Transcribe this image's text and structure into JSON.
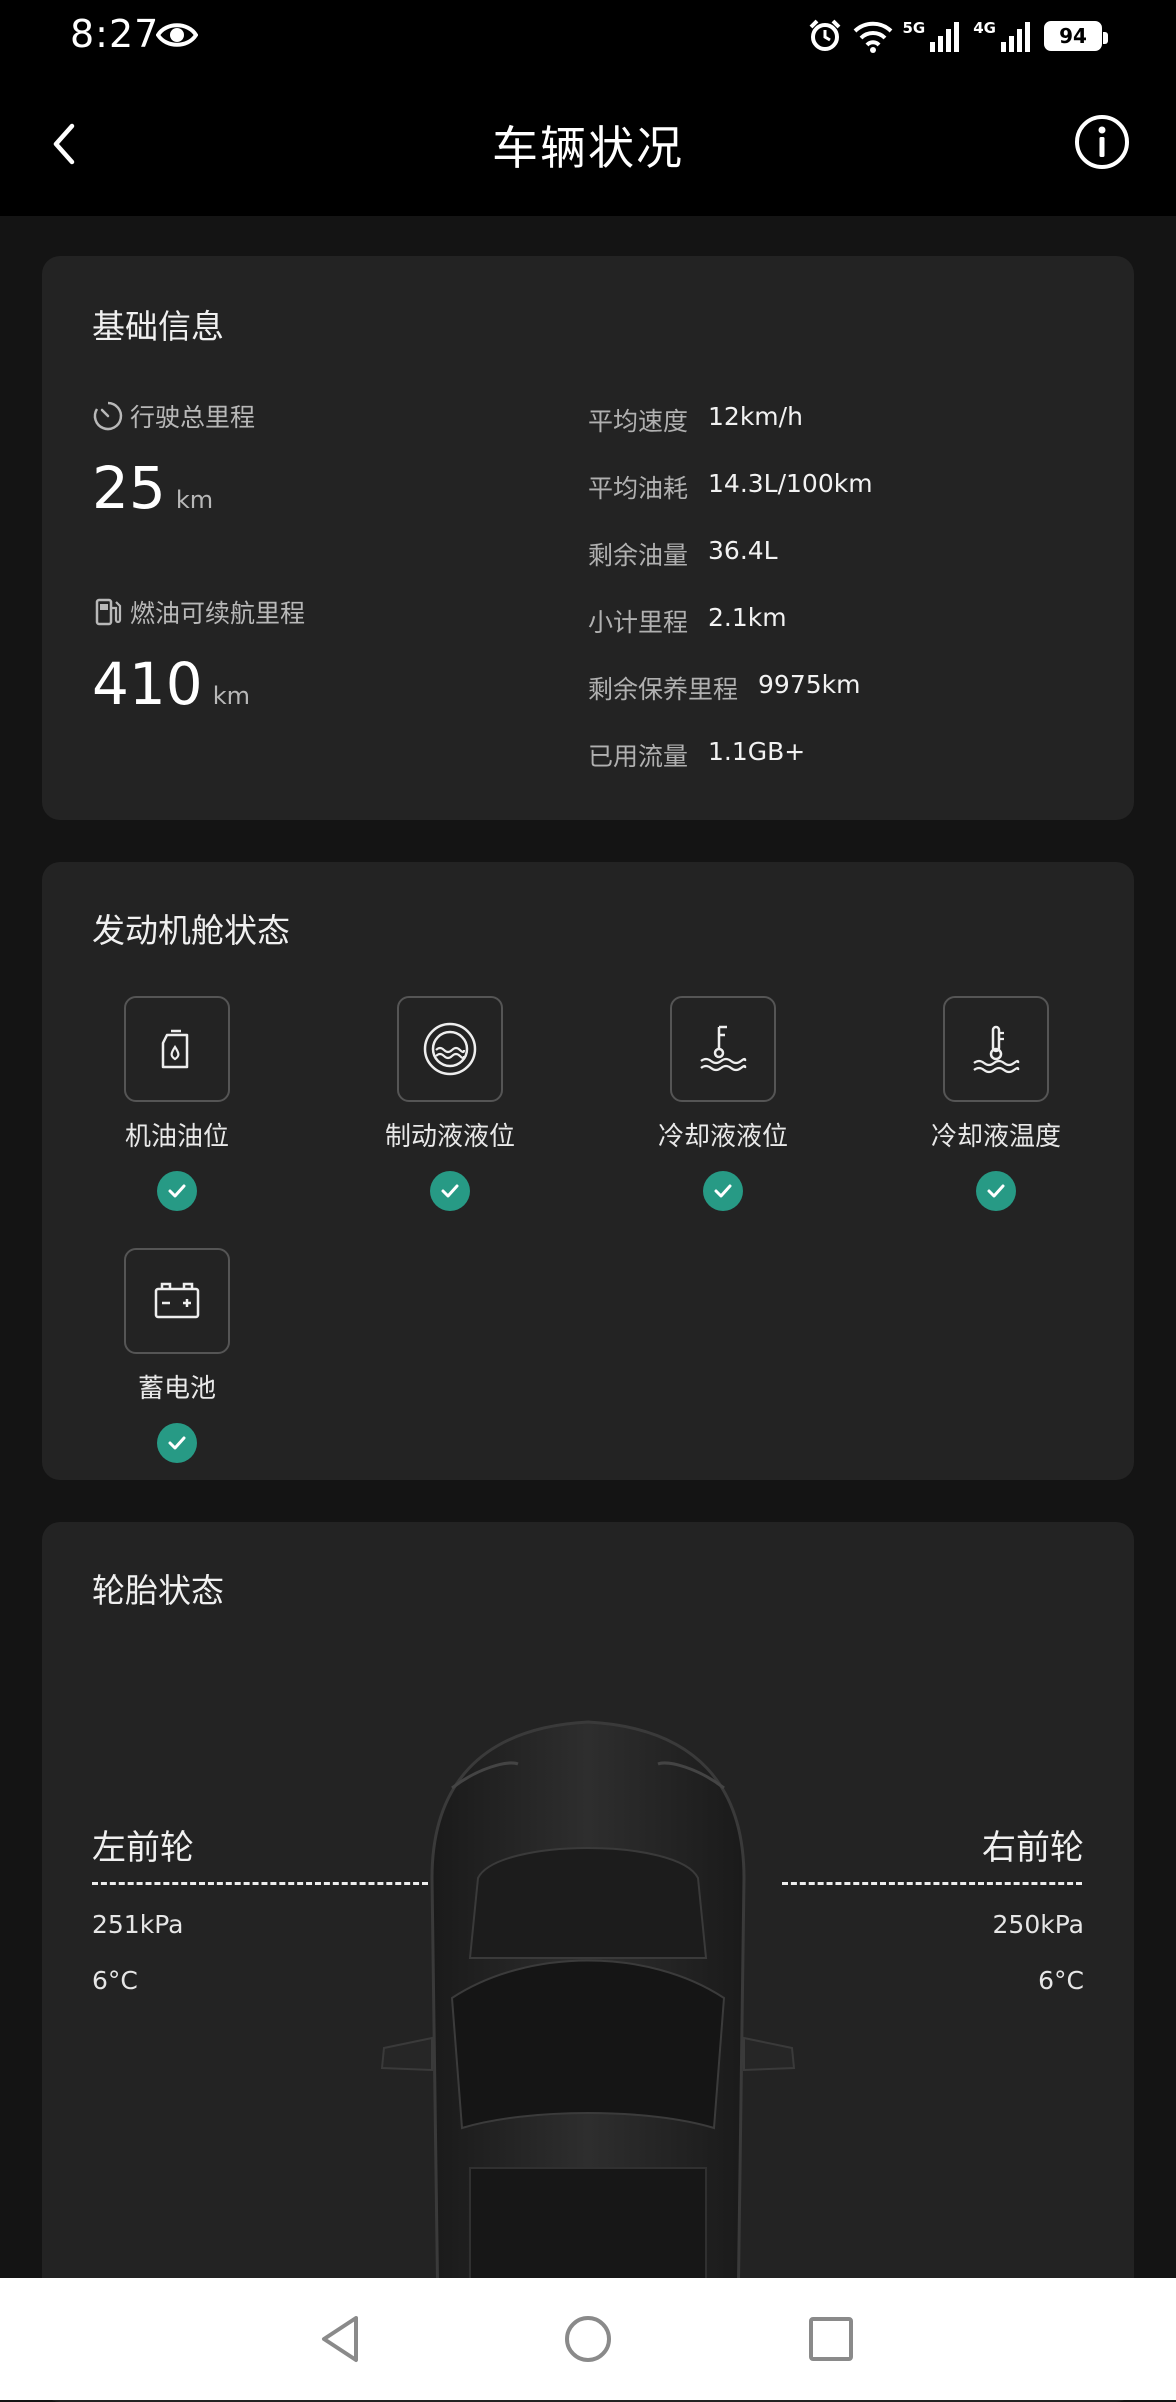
{
  "status_bar": {
    "time": "8:27",
    "net_1": "5G",
    "net_2": "4G",
    "battery": "94"
  },
  "header": {
    "title": "车辆状况"
  },
  "basic_info": {
    "title": "基础信息",
    "total_mileage_label": "行驶总里程",
    "total_mileage_value": "25",
    "total_mileage_unit": "km",
    "range_label": "燃油可续航里程",
    "range_value": "410",
    "range_unit": "km",
    "rows": [
      {
        "key": "平均速度",
        "value": "12km/h"
      },
      {
        "key": "平均油耗",
        "value": "14.3L/100km"
      },
      {
        "key": "剩余油量",
        "value": "36.4L"
      },
      {
        "key": "小计里程",
        "value": "2.1km"
      },
      {
        "key": "剩余保养里程",
        "value": "9975km"
      },
      {
        "key": "已用流量",
        "value": "1.1GB+"
      }
    ]
  },
  "engine": {
    "title": "发动机舱状态",
    "items": [
      {
        "label": "机油油位",
        "icon": "oil-level-icon",
        "status": "ok"
      },
      {
        "label": "制动液液位",
        "icon": "brake-fluid-icon",
        "status": "ok"
      },
      {
        "label": "冷却液液位",
        "icon": "coolant-level-icon",
        "status": "ok"
      },
      {
        "label": "冷却液温度",
        "icon": "coolant-temperature-icon",
        "status": "ok"
      },
      {
        "label": "蓄电池",
        "icon": "battery-icon",
        "status": "ok"
      }
    ]
  },
  "tires": {
    "title": "轮胎状态",
    "front_left": {
      "label": "左前轮",
      "pressure": "251kPa",
      "temp": "6°C"
    },
    "front_right": {
      "label": "右前轮",
      "pressure": "250kPa",
      "temp": "6°C"
    }
  },
  "colors": {
    "ok_badge": "#279a85",
    "card_bg": "#232323",
    "page_bg": "#141414"
  }
}
